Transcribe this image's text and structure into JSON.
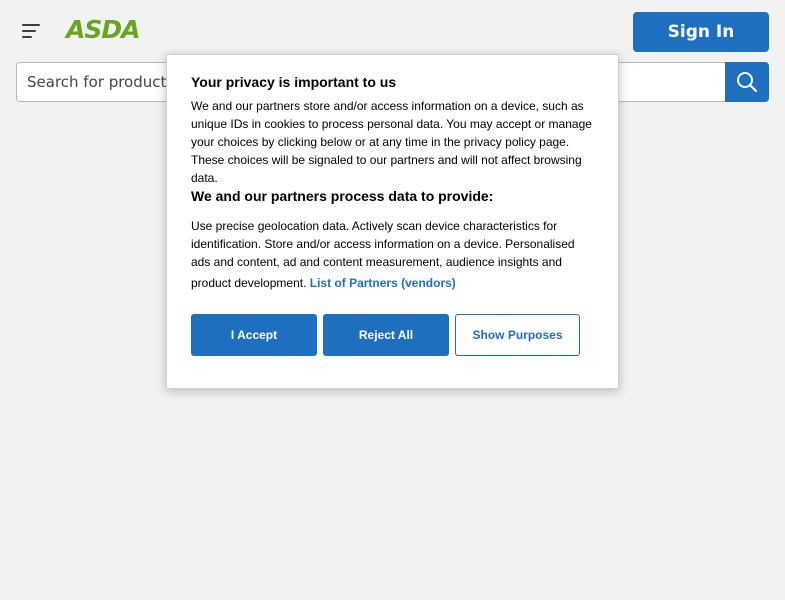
{
  "header": {
    "menu_icon": "hamburger-menu-icon",
    "logo_text": "ASDA",
    "brand_color": "#68a51c",
    "accent_color": "#1f6fc1",
    "signin_label": "Sign In"
  },
  "search": {
    "placeholder": "Search for products",
    "button_icon": "search-icon"
  },
  "consent": {
    "title": "Your privacy is important to us",
    "body": "We and our partners store and/or access information on a device, such as unique IDs in cookies to process personal data. You may accept or manage your choices by clicking below or at any time in the privacy policy page. These choices will be signaled to our partners and will not affect browsing data.",
    "subtitle": "We and our partners process data to provide:",
    "purposes": "Use precise geolocation data. Actively scan device characteristics for identification. Store and/or access information on a device. Personalised ads and content, ad and content measurement, audience insights and",
    "purposes_tail": "product development.",
    "partners_link": "List of Partners (vendors)",
    "accept_label": "I Accept",
    "reject_label": "Reject All",
    "show_purposes_label": "Show Purposes"
  }
}
